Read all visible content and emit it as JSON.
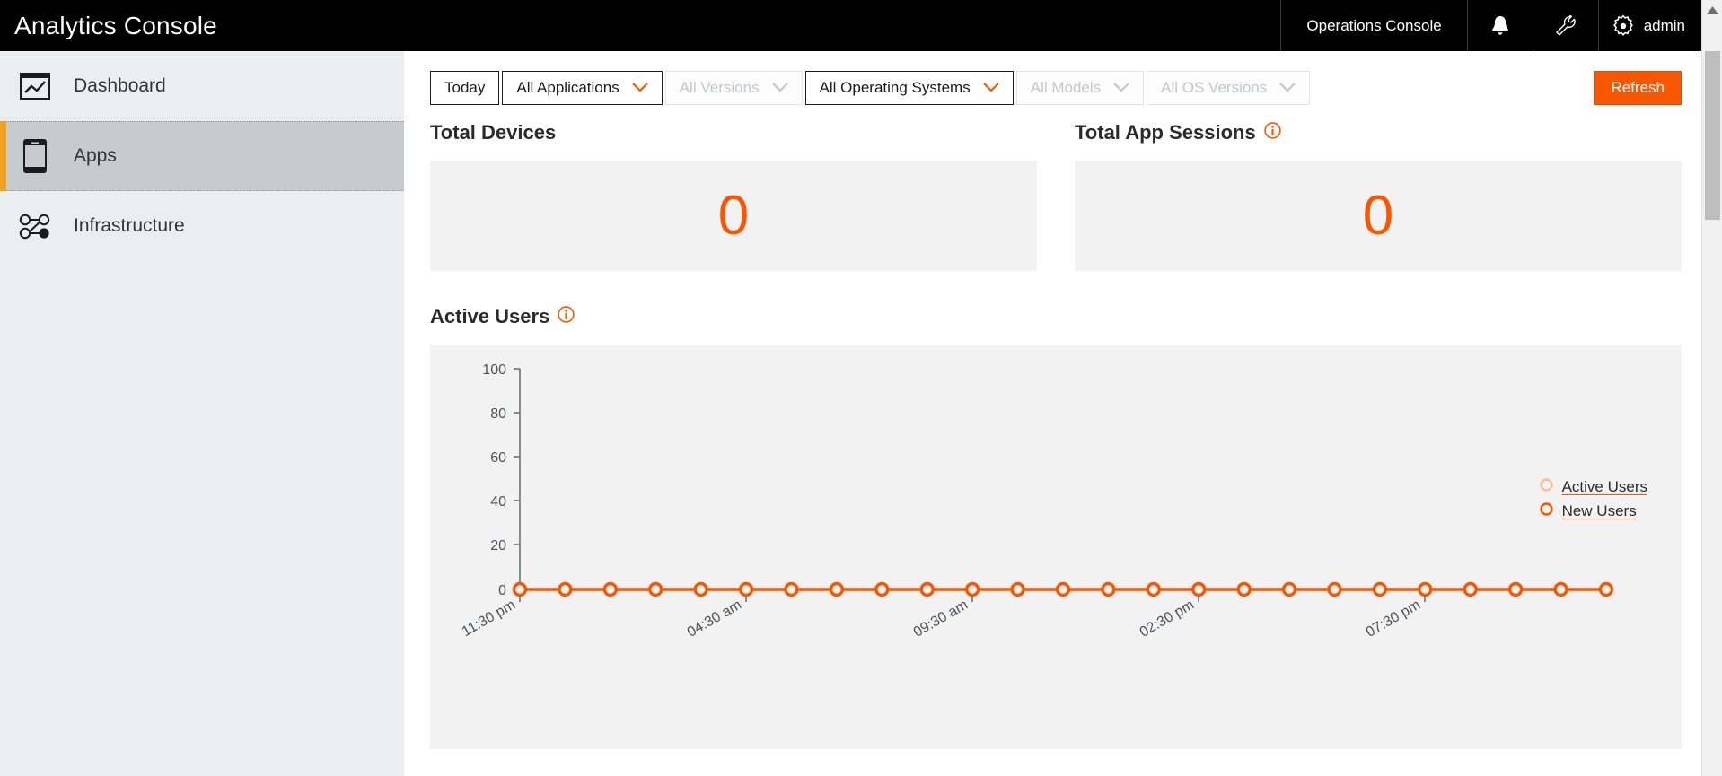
{
  "app": {
    "brand": "Analytics Console",
    "accent_color": "#f95601",
    "topbar_bg": "#000000",
    "sidebar_bg": "#eaeef1",
    "panel_bg": "#f2f2f2"
  },
  "topnav": {
    "console_link": "Operations Console",
    "icons": [
      "bell-icon",
      "wrench-icon",
      "gear-icon"
    ],
    "user": "admin"
  },
  "sidebar": {
    "items": [
      {
        "label": "Dashboard",
        "icon": "chart-window-icon",
        "active": false
      },
      {
        "label": "Apps",
        "icon": "mobile-phone-icon",
        "active": true
      },
      {
        "label": "Infrastructure",
        "icon": "network-nodes-icon",
        "active": false
      }
    ]
  },
  "toolbar": {
    "filters": [
      {
        "label": "Today",
        "has_chevron": false,
        "disabled": false
      },
      {
        "label": "All Applications",
        "has_chevron": true,
        "disabled": false
      },
      {
        "label": "All Versions",
        "has_chevron": true,
        "disabled": true
      },
      {
        "label": "All Operating Systems",
        "has_chevron": true,
        "disabled": false
      },
      {
        "label": "All Models",
        "has_chevron": true,
        "disabled": true
      },
      {
        "label": "All OS Versions",
        "has_chevron": true,
        "disabled": true
      }
    ],
    "refresh_label": "Refresh"
  },
  "metrics": [
    {
      "title": "Total Devices",
      "value": "0",
      "info": false
    },
    {
      "title": "Total App Sessions",
      "value": "0",
      "info": true
    }
  ],
  "chart_section": {
    "title": "Active Users",
    "info": true
  },
  "chart_data": {
    "type": "line",
    "title": "Active Users",
    "xlabel": "",
    "ylabel": "",
    "ylim": [
      0,
      100
    ],
    "yticks": [
      0,
      20,
      40,
      60,
      80,
      100
    ],
    "grid": false,
    "legend_position": "right",
    "xtick_labels": [
      "11:30 pm",
      "04:30 am",
      "09:30 am",
      "02:30 pm",
      "07:30 pm"
    ],
    "xtick_positions": [
      0,
      5,
      10,
      15,
      20
    ],
    "x": [
      0,
      1,
      2,
      3,
      4,
      5,
      6,
      7,
      8,
      9,
      10,
      11,
      12,
      13,
      14,
      15,
      16,
      17,
      18,
      19,
      20,
      21,
      22,
      23,
      24
    ],
    "series": [
      {
        "name": "Active Users",
        "color": "#fbbf94",
        "values": [
          0,
          0,
          0,
          0,
          0,
          0,
          0,
          0,
          0,
          0,
          0,
          0,
          0,
          0,
          0,
          0,
          0,
          0,
          0,
          0,
          0,
          0,
          0,
          0,
          0
        ]
      },
      {
        "name": "New Users",
        "color": "#f95601",
        "values": [
          0,
          0,
          0,
          0,
          0,
          0,
          0,
          0,
          0,
          0,
          0,
          0,
          0,
          0,
          0,
          0,
          0,
          0,
          0,
          0,
          0,
          0,
          0,
          0,
          0
        ]
      }
    ]
  },
  "scrollbar": {
    "position": "right",
    "arrow": "up-arrow-icon"
  }
}
